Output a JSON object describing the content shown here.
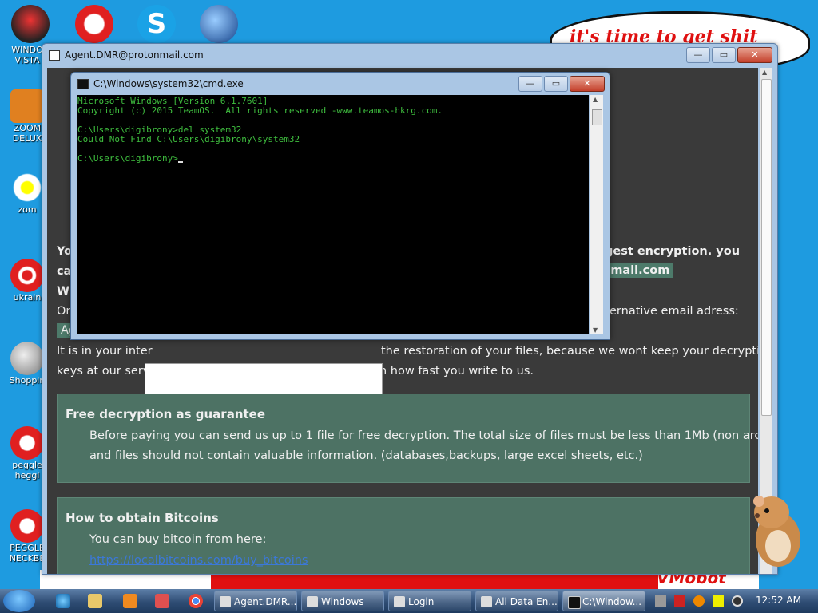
{
  "desktop": {
    "icons": [
      {
        "label1": "WINDO",
        "label2": "VISTA"
      },
      {
        "label1": "ZOOM",
        "label2": "DELUX"
      },
      {
        "label1": "zom",
        "label2": ""
      },
      {
        "label1": "ukrain",
        "label2": ""
      },
      {
        "label1": "Shoppin",
        "label2": ""
      },
      {
        "label1": "peggle",
        "label2": "heggl"
      },
      {
        "label1": "PEGGLE",
        "label2": "NECKBE"
      }
    ],
    "bubble_text": "it's time to get shit",
    "banner_text": "VMobot"
  },
  "agent_window": {
    "title": "Agent.DMR@protonmail.com",
    "content": {
      "line1_left": "Yo",
      "line1_right": "gest encryption. you",
      "line2_left": "ca",
      "line2_right": "nmail.com",
      "line3_left": "W",
      "line4_left": "Or",
      "line4_right": "ernative email adress:",
      "line5_left": "Ag",
      "line6a": "It is in your inter",
      "line6b": "the restoration of your files, because we wont keep your decryption",
      "line7a": "keys at our serv",
      "line7b": "n how fast you write to us.",
      "panel1_title": "Free decryption as guarantee",
      "panel1_line1": "Before paying you can send us up to 1 file for free decryption. The total size of files must be less than 1Mb (non archived),",
      "panel1_line2": "and files should not contain valuable information. (databases,backups, large excel sheets, etc.)",
      "panel2_title": "How to obtain Bitcoins",
      "panel2_line1": "You can buy bitcoin from here:",
      "panel2_link": "https://localbitcoins.com/buy_bitcoins"
    }
  },
  "cmd_window": {
    "title": "C:\\Windows\\system32\\cmd.exe",
    "lines": [
      "Microsoft Windows [Version 6.1.7601]",
      "Copyright (c) 2015 TeamOS.  All rights reserved -www.teamos-hkrg.com.",
      "",
      "C:\\Users\\digibrony>del system32",
      "Could Not Find C:\\Users\\digibrony\\system32",
      "",
      "C:\\Users\\digibrony>"
    ]
  },
  "window_buttons": {
    "minimize": "—",
    "maximize": "▭",
    "close": "✕"
  },
  "taskbar": {
    "tasks": [
      {
        "label": "Agent.DMR..."
      },
      {
        "label": "Windows"
      },
      {
        "label": "Login"
      },
      {
        "label": "All Data En..."
      },
      {
        "label": "C:\\Window..."
      }
    ],
    "clock": "12:52 AM"
  },
  "colors": {
    "desktop": "#1e9be0",
    "cmd_text": "#3fbf3f",
    "panel": "#4d7264",
    "highlight": "#4d7a6a",
    "banner_red": "#e01010"
  },
  "icons": [
    "windows-start-icon",
    "ie-icon",
    "folder-icon",
    "media-player-icon",
    "chrome-icon",
    "cmd-icon"
  ]
}
